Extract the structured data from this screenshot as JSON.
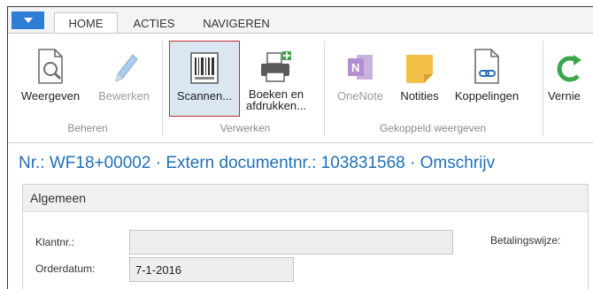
{
  "tabs": [
    "HOME",
    "ACTIES",
    "NAVIGEREN"
  ],
  "ribbon": {
    "buttons": {
      "weergeven": "Weergeven",
      "bewerken": "Bewerken",
      "scannen": "Scannen...",
      "boeken1": "Boeken en",
      "boeken2": "afdrukken...",
      "onenote": "OneNote",
      "notities": "Notities",
      "koppelingen": "Koppelingen",
      "vernieuwen": "Vernie"
    },
    "groups": {
      "beheren": "Beheren",
      "verwerken": "Verwerken",
      "gekoppeld": "Gekoppeld weergeven"
    }
  },
  "page_title": "Nr.: WF18+00002 · Extern documentnr.: 103831568 · Omschrijv",
  "fasttab": {
    "title": "Algemeen",
    "klantnr_label": "Klantnr.:",
    "klantnr_value": "",
    "orderdatum_label": "Orderdatum:",
    "orderdatum_value": "7-1-2016",
    "betalingswijze_label": "Betalingswijze:"
  },
  "colors": {
    "accent": "#2e7dd6",
    "title": "#1e6fb5",
    "highlight_border": "#c62828",
    "highlight_fill": "#dbe6f3",
    "onenote": "#7a3aa6",
    "notes": "#f4c04a"
  },
  "icons": [
    "menu-dropdown-icon",
    "view-document-icon",
    "edit-pencil-icon",
    "barcode-scan-icon",
    "print-icon",
    "onenote-icon",
    "sticky-note-icon",
    "link-document-icon",
    "refresh-icon"
  ]
}
